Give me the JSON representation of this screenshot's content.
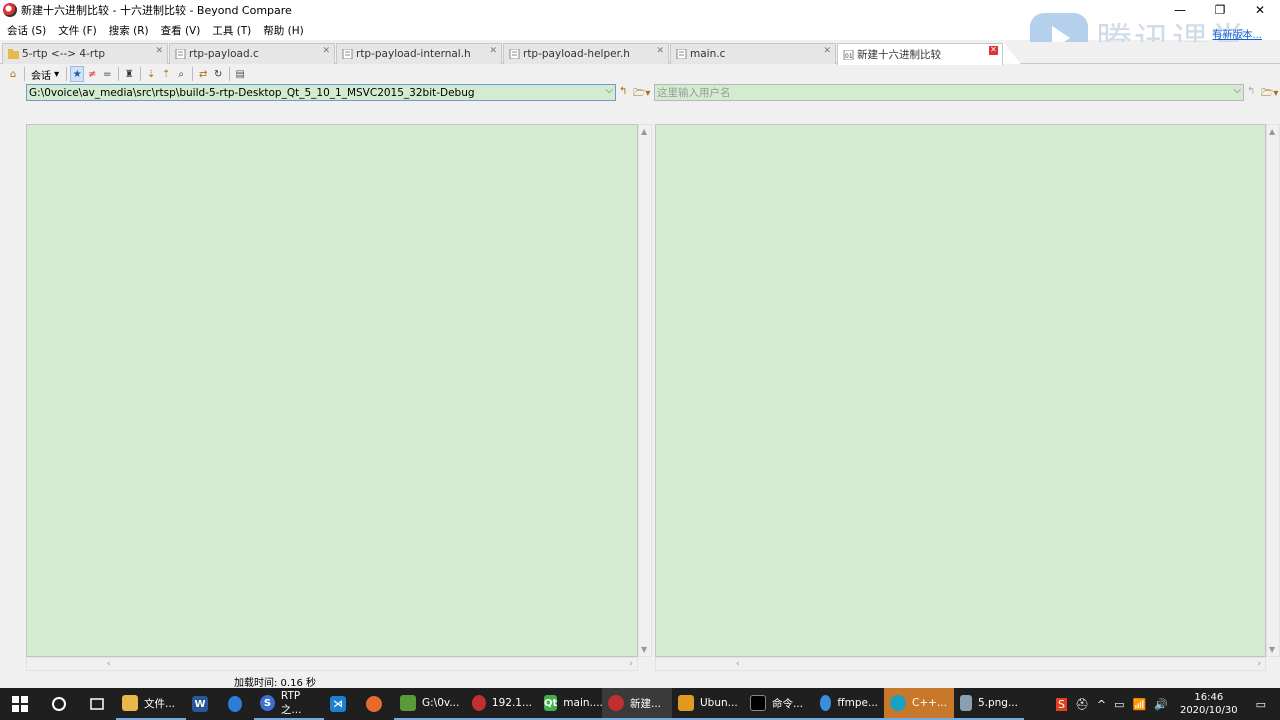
{
  "window": {
    "title": "新建十六进制比较 - 十六进制比较 - Beyond Compare",
    "controls": [
      "—",
      "❐",
      "✕"
    ],
    "update_link": "有新版本..."
  },
  "watermark": {
    "text": "腾讯课堂"
  },
  "menu": [
    "会话 (S)",
    "文件 (F)",
    "搜索 (R)",
    "查看 (V)",
    "工具 (T)",
    "帮助 (H)"
  ],
  "tabs": [
    {
      "label": "5-rtp <--> 4-rtp",
      "active": false
    },
    {
      "label": "rtp-payload.c",
      "active": false
    },
    {
      "label": "rtp-payload-internal.h",
      "active": false
    },
    {
      "label": "rtp-payload-helper.h",
      "active": false
    },
    {
      "label": "main.c",
      "active": false
    },
    {
      "label": "新建十六进制比较",
      "active": true
    }
  ],
  "toolbar": {
    "session_label": "会话",
    "buttons": [
      "★",
      "≠",
      "="
    ]
  },
  "left_path": {
    "value": "G:\\0voice\\av_media\\src\\rtsp\\build-5-rtp-Desktop_Qt_5_10_1_MSVC2015_32bit-Debug"
  },
  "right_path": {
    "placeholder": "这里输入用户名"
  },
  "status": {
    "load_time": "加载时间: 0.16 秒"
  },
  "taskbar": {
    "items": [
      {
        "label": "",
        "icon": "windows-icon",
        "color": "#ffffff"
      },
      {
        "label": "",
        "icon": "cortana-icon",
        "color": "#ffffff"
      },
      {
        "label": "",
        "icon": "task-view-icon",
        "color": "#ffffff"
      },
      {
        "label": "文件...",
        "icon": "folder-icon",
        "color": "#e8b84a"
      },
      {
        "label": "",
        "icon": "word-icon",
        "color": "#2b5797"
      },
      {
        "label": "",
        "icon": "browser-icon",
        "color": "#2f7bd8"
      },
      {
        "label": "RTP之...",
        "icon": "sogou-icon",
        "color": "#3b6fd0"
      },
      {
        "label": "",
        "icon": "vscode-icon",
        "color": "#1f7fd0"
      },
      {
        "label": "",
        "icon": "firefox-icon",
        "color": "#e8692a"
      },
      {
        "label": "G:\\0v...",
        "icon": "notepad-icon",
        "color": "#5a9a3a"
      },
      {
        "label": "192.1...",
        "icon": "xshell-icon",
        "color": "#c03030"
      },
      {
        "label": "main....",
        "icon": "qt-icon",
        "color": "#41b04a"
      },
      {
        "label": "新建...",
        "icon": "beyond-compare-icon",
        "color": "#c03030"
      },
      {
        "label": "Ubun...",
        "icon": "vmware-icon",
        "color": "#e09a20"
      },
      {
        "label": "命令...",
        "icon": "cmd-icon",
        "color": "#000000"
      },
      {
        "label": "ffmpe...",
        "icon": "globe-icon",
        "color": "#3a8fd8"
      },
      {
        "label": "C++...",
        "icon": "cpp-icon",
        "color": "#1aa0c0"
      },
      {
        "label": "5.png...",
        "icon": "image-viewer-icon",
        "color": "#8aa0b0"
      }
    ],
    "tray_icons": [
      "S",
      "⛑",
      "▭",
      "📶",
      "🔊"
    ],
    "time": "16:46",
    "date": "2020/10/30"
  },
  "colors": {
    "pane_bg": "#d3ecd0",
    "active_border": "#6b9ad6"
  }
}
